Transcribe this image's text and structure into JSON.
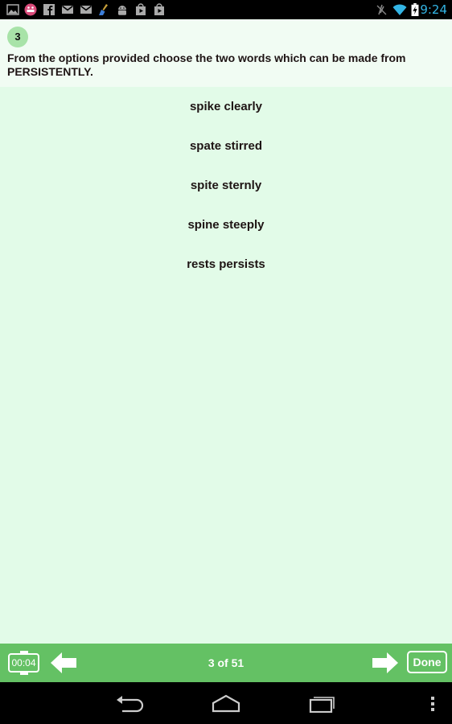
{
  "status_bar": {
    "time": "9:24",
    "left_icons": [
      "gallery-icon",
      "face-app-icon",
      "facebook-icon",
      "gmail-icon",
      "gmail-icon",
      "cleaner-icon",
      "android-icon",
      "play-store-icon",
      "play-store-icon"
    ],
    "right_icons": [
      "vibrate-off-icon",
      "wifi-icon",
      "battery-charging-icon"
    ],
    "accent_color": "#33b5e5"
  },
  "question": {
    "number": "3",
    "text": "From the options provided choose the two words which can be made from PERSISTENTLY."
  },
  "options": [
    {
      "label": "spike  clearly"
    },
    {
      "label": "spate  stirred"
    },
    {
      "label": "spite  sternly"
    },
    {
      "label": "spine  steeply"
    },
    {
      "label": "rests  persists"
    }
  ],
  "toolbar": {
    "timer": "00:04",
    "page": "3 of 51",
    "done_label": "Done",
    "prev_icon": "arrow-left-icon",
    "next_icon": "arrow-right-icon",
    "color": "#64c164"
  },
  "nav_bar": {
    "buttons": [
      "back-icon",
      "home-icon",
      "recent-apps-icon",
      "menu-icon"
    ]
  },
  "colors": {
    "content_bg": "#e2fbe8",
    "question_bg": "#f1fcf3",
    "badge_bg": "#a8e3a8",
    "text": "#1e1414"
  }
}
